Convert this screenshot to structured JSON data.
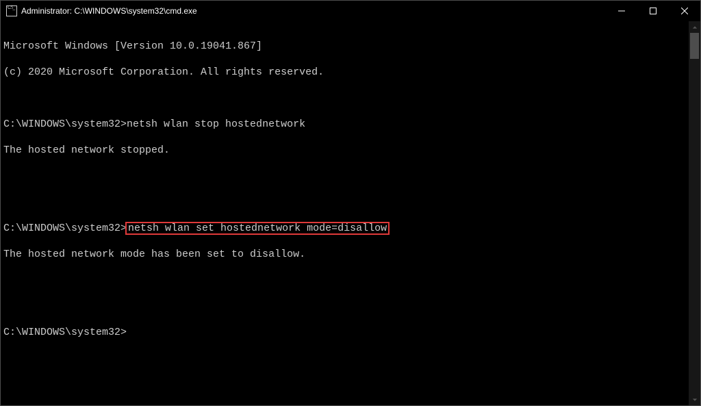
{
  "titlebar": {
    "title": "Administrator: C:\\WINDOWS\\system32\\cmd.exe"
  },
  "terminal": {
    "line1": "Microsoft Windows [Version 10.0.19041.867]",
    "line2": "(c) 2020 Microsoft Corporation. All rights reserved.",
    "blank1": "",
    "prompt1": "C:\\WINDOWS\\system32>",
    "cmd1": "netsh wlan stop hostednetwork",
    "out1": "The hosted network stopped.",
    "blank2": "",
    "blank3": "",
    "prompt2": "C:\\WINDOWS\\system32>",
    "cmd2": "netsh wlan set hostednetwork mode=disallow",
    "out2": "The hosted network mode has been set to disallow.",
    "blank4": "",
    "blank5": "",
    "prompt3": "C:\\WINDOWS\\system32>"
  }
}
